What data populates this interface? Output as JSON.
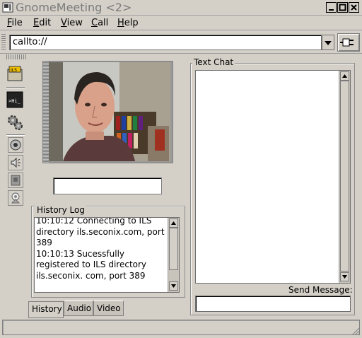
{
  "window": {
    "title": "GnomeMeeting <2>",
    "buttons": [
      "minimize-icon",
      "maximize-icon",
      "close-icon"
    ]
  },
  "menu": {
    "file": {
      "mnemonic": "F",
      "rest": "ile"
    },
    "edit": {
      "mnemonic": "E",
      "rest": "dit"
    },
    "view": {
      "mnemonic": "V",
      "rest": "iew"
    },
    "call": {
      "mnemonic": "C",
      "rest": "all"
    },
    "help": {
      "mnemonic": "H",
      "rest": "elp"
    }
  },
  "urlbar": {
    "value": "callto://",
    "dropdown_icon": "triangle-down-icon",
    "connect_icon": "plug-icon"
  },
  "toolbar": {
    "buttons": [
      "ils-directory-icon",
      "text-chat-icon",
      "settings-gears-icon",
      "video-preview-icon",
      "speaker-volume-icon",
      "hold-icon",
      "camera-icon"
    ]
  },
  "status_entry": {
    "value": ""
  },
  "history": {
    "legend": "History Log",
    "lines": [
      "10:10:12 Connecting to ILS directory ils.seconix.com, port 389",
      "10:10:13 Sucessfully registered to ILS directory ils.seconix. com, port 389"
    ]
  },
  "tabs": {
    "history": "History",
    "audio": "Audio",
    "video": "Video",
    "selected": "History"
  },
  "chat": {
    "legend": "Text Chat",
    "send_label": "Send Message:",
    "message_value": ""
  },
  "colors": {
    "window_bg": "#d4d0c8",
    "field_bg": "#ffffff"
  }
}
